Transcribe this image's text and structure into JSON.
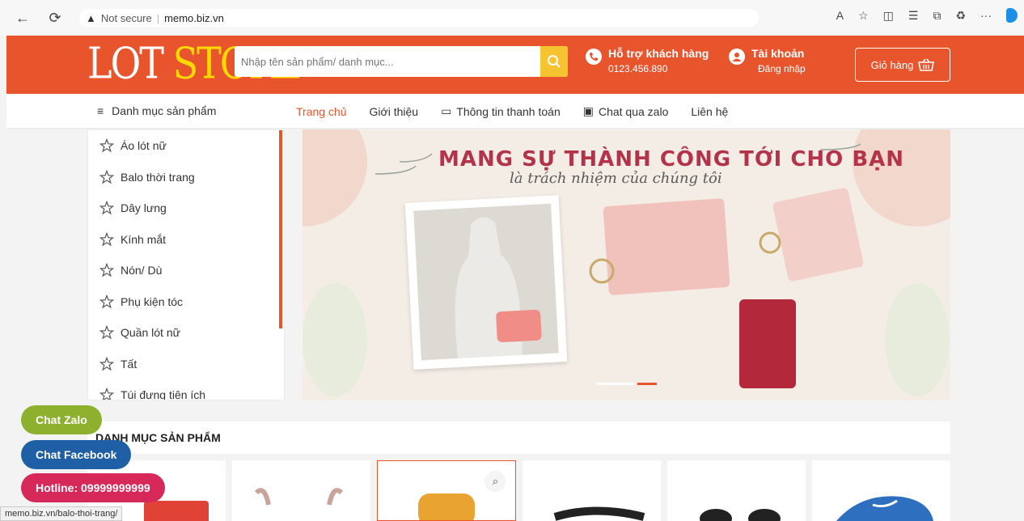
{
  "browser": {
    "security": "Not secure",
    "url": "memo.biz.vn",
    "status_url": "memo.biz.vn/balo-thoi-trang/"
  },
  "header": {
    "logo_lot": "LOT",
    "logo_store": "STORE",
    "search_placeholder": "Nhập tên sản phẩm/ danh mục...",
    "support_title": "Hỗ trợ khách hàng",
    "support_phone": "0123.456.890",
    "account_title": "Tài khoản",
    "account_sub": "Đăng nhập",
    "cart_label": "Giỏ hàng"
  },
  "nav": {
    "category_label": "Danh mục sản phẩm",
    "items": [
      "Trang chủ",
      "Giới thiệu",
      "Thông tin thanh toán",
      "Chat qua zalo",
      "Liên hệ"
    ]
  },
  "sidebar": {
    "items": [
      "Áo lót nữ",
      "Balo thời trang",
      "Dây lưng",
      "Kính mắt",
      "Nón/ Dù",
      "Phụ kiện tóc",
      "Quần lót nữ",
      "Tất",
      "Túi đựng tiện ích"
    ]
  },
  "banner": {
    "title": "MANG SỰ THÀNH CÔNG TỚI CHO BẠN",
    "subtitle": "là trách nhiệm của chúng tôi",
    "active_slide": 2,
    "slide_count": 2
  },
  "section": {
    "title": "DANH MỤC SẢN PHẨM"
  },
  "floating": {
    "zalo": "Chat Zalo",
    "facebook": "Chat Facebook",
    "hotline": "Hotline: 09999999999"
  },
  "colors": {
    "primary": "#e8552d",
    "logo_accent": "#ffd900",
    "search_button": "#f6c331",
    "zalo": "#8db12e",
    "facebook": "#1e5fa5",
    "hotline": "#d7285a"
  }
}
